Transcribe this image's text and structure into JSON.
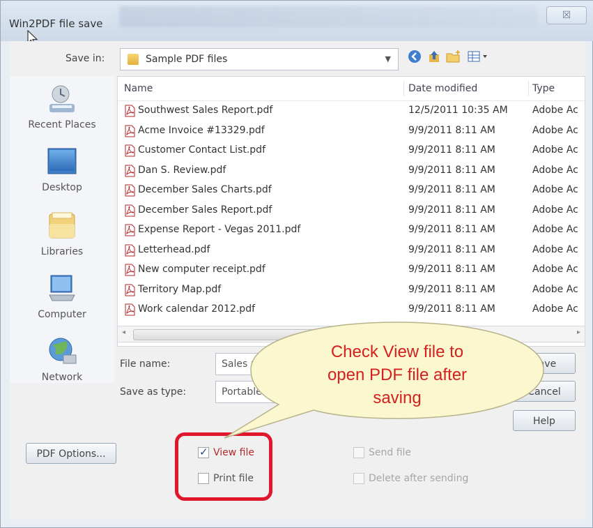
{
  "window": {
    "title": "Win2PDF file save",
    "close_label": "☒"
  },
  "save_in": {
    "label": "Save in:",
    "value": "Sample PDF files"
  },
  "places": [
    {
      "label": "Recent Places",
      "icon": "recent-places-icon"
    },
    {
      "label": "Desktop",
      "icon": "desktop-icon"
    },
    {
      "label": "Libraries",
      "icon": "libraries-icon"
    },
    {
      "label": "Computer",
      "icon": "computer-icon"
    },
    {
      "label": "Network",
      "icon": "network-icon"
    }
  ],
  "columns": {
    "name": "Name",
    "date": "Date modified",
    "type": "Type"
  },
  "files": [
    {
      "name": "Southwest Sales Report.pdf",
      "date": "12/5/2011 10:35 AM",
      "type": "Adobe Ac"
    },
    {
      "name": "Acme Invoice #13329.pdf",
      "date": "9/9/2011 8:11 AM",
      "type": "Adobe Ac"
    },
    {
      "name": "Customer Contact List.pdf",
      "date": "9/9/2011 8:11 AM",
      "type": "Adobe Ac"
    },
    {
      "name": "Dan S. Review.pdf",
      "date": "9/9/2011 8:11 AM",
      "type": "Adobe Ac"
    },
    {
      "name": "December Sales Charts.pdf",
      "date": "9/9/2011 8:11 AM",
      "type": "Adobe Ac"
    },
    {
      "name": "December Sales Report.pdf",
      "date": "9/9/2011 8:11 AM",
      "type": "Adobe Ac"
    },
    {
      "name": "Expense Report - Vegas 2011.pdf",
      "date": "9/9/2011 8:11 AM",
      "type": "Adobe Ac"
    },
    {
      "name": "Letterhead.pdf",
      "date": "9/9/2011 8:11 AM",
      "type": "Adobe Ac"
    },
    {
      "name": "New computer receipt.pdf",
      "date": "9/9/2011 8:11 AM",
      "type": "Adobe Ac"
    },
    {
      "name": "Territory Map.pdf",
      "date": "9/9/2011 8:11 AM",
      "type": "Adobe Ac"
    },
    {
      "name": "Work calendar 2012.pdf",
      "date": "9/9/2011 8:11 AM",
      "type": "Adobe Ac"
    }
  ],
  "file_name": {
    "label": "File name:",
    "value": "Sales r"
  },
  "save_as_type": {
    "label": "Save as type:",
    "value": "Portable"
  },
  "buttons": {
    "save": "Save",
    "cancel": "Cancel",
    "help": "Help",
    "pdf_options": "PDF Options..."
  },
  "options": {
    "view_file": {
      "label": "View file",
      "checked": true
    },
    "print_file": {
      "label": "Print file",
      "checked": false
    },
    "send_file": {
      "label": "Send file",
      "checked": false
    },
    "delete_after_sending": {
      "label": "Delete after sending",
      "checked": false
    }
  },
  "callout": {
    "line1": "Check View file to",
    "line2": "open PDF file after",
    "line3": "saving"
  },
  "colors": {
    "callout_fill": "#fbf7cf",
    "callout_text": "#d42020",
    "highlight": "#e0172a",
    "pdf_icon": "#b3262a"
  }
}
